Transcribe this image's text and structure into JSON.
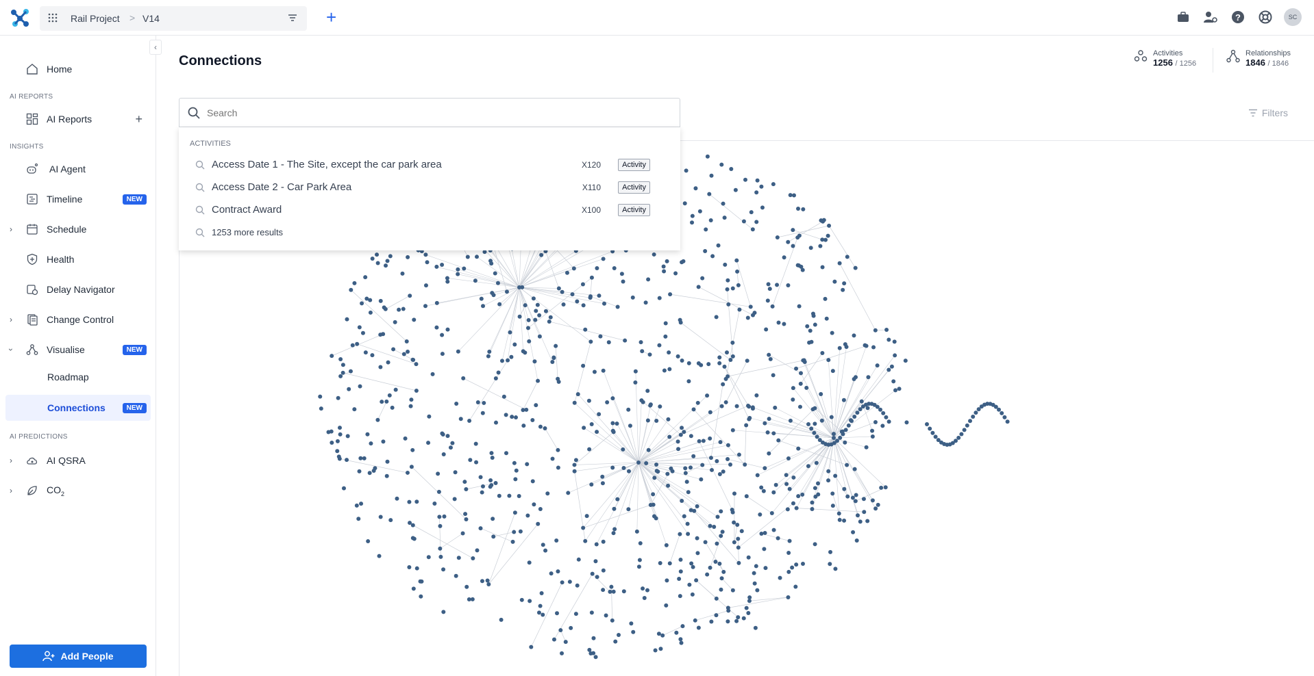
{
  "topbar": {
    "project": "Rail Project",
    "separator": ">",
    "version": "V14",
    "avatar_initials": "SC",
    "icons": [
      "briefcase-icon",
      "user-settings-icon",
      "help-icon",
      "support-icon"
    ]
  },
  "sidebar": {
    "items": {
      "home": "Home",
      "ai_reports": "AI Reports",
      "ai_agent": "AI Agent",
      "timeline": "Timeline",
      "schedule": "Schedule",
      "health": "Health",
      "delay_navigator": "Delay Navigator",
      "change_control": "Change Control",
      "visualise": "Visualise",
      "roadmap": "Roadmap",
      "connections": "Connections",
      "ai_qsra": "AI QSRA",
      "co2": "CO",
      "co2_sub": "2"
    },
    "sections": {
      "ai_reports": "AI REPORTS",
      "insights": "INSIGHTS",
      "ai_predictions": "AI PREDICTIONS"
    },
    "badge_new": "NEW",
    "add_people": "Add People"
  },
  "main": {
    "title": "Connections",
    "stats": {
      "activities_label": "Activities",
      "activities_value": "1256",
      "activities_total": "/ 1256",
      "relationships_label": "Relationships",
      "relationships_value": "1846",
      "relationships_total": "/ 1846"
    },
    "filters_label": "Filters",
    "search": {
      "placeholder": "Search",
      "section": "ACTIVITIES",
      "results": [
        {
          "name": "Access Date 1 - The Site, except the car park area",
          "code": "X120",
          "tag": "Activity"
        },
        {
          "name": "Access Date 2 - Car Park Area",
          "code": "X110",
          "tag": "Activity"
        },
        {
          "name": "Contract Award",
          "code": "X100",
          "tag": "Activity"
        }
      ],
      "more": "1253 more results"
    }
  },
  "colors": {
    "accent": "#2563eb",
    "node": "#3d5f85",
    "edge": "#c9ced6"
  }
}
